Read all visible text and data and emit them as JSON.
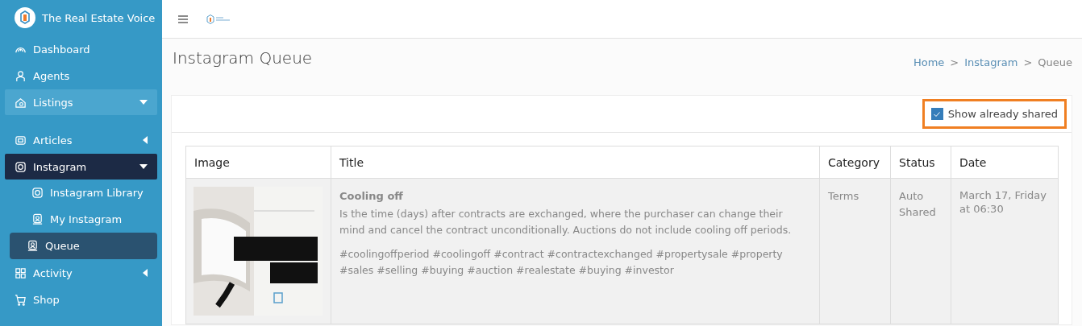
{
  "brand": {
    "name": "The Real Estate Voice"
  },
  "sidebar": {
    "items": [
      {
        "label": "Dashboard",
        "kind": "link",
        "selected": false
      },
      {
        "label": "Agents",
        "kind": "link",
        "selected": false
      },
      {
        "label": "Listings",
        "kind": "group",
        "selected": false,
        "expanded": true
      },
      {
        "label": "Articles",
        "kind": "group",
        "selected": false,
        "expanded": false
      },
      {
        "label": "Instagram",
        "kind": "group",
        "selected": true,
        "expanded": true,
        "children": [
          {
            "label": "Instagram Library",
            "selected": false
          },
          {
            "label": "My Instagram",
            "selected": false
          },
          {
            "label": "Queue",
            "selected": true
          }
        ]
      },
      {
        "label": "Activity",
        "kind": "group",
        "selected": false,
        "expanded": false
      },
      {
        "label": "Shop",
        "kind": "link",
        "selected": false
      }
    ]
  },
  "page": {
    "title": "Instagram Queue",
    "breadcrumb": [
      "Home",
      "Instagram",
      "Queue"
    ],
    "separator": ">"
  },
  "filter": {
    "label": "Show already shared",
    "checked": true,
    "highlighted": true
  },
  "table": {
    "columns": [
      "Image",
      "Title",
      "Category",
      "Status",
      "Date"
    ],
    "rows": [
      {
        "title": "Cooling off",
        "description": "Is the time (days) after contracts are exchanged, where the purchaser can change their mind and cancel the contract unconditionally. Auctions do not include cooling off periods.",
        "hashtags": "#coolingoffperiod #coolingoff #contract #contractexchanged #propertysale #property #sales #selling #buying #auction #realestate #buying #investor",
        "category": "Terms",
        "status": "Auto Shared",
        "date": "March 17, Friday at 06:30"
      }
    ]
  }
}
